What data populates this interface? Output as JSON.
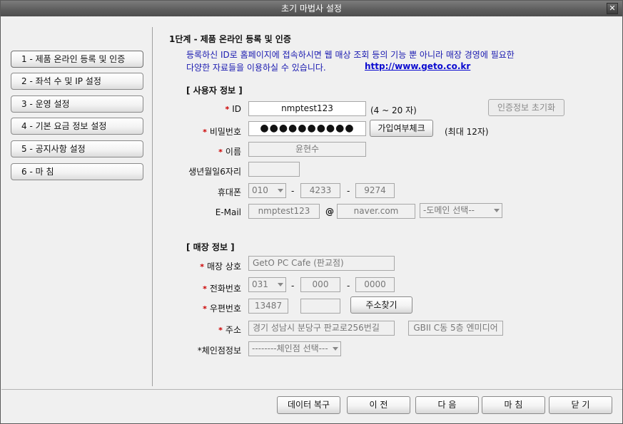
{
  "window": {
    "title": "초기 마법사 설정",
    "close_symbol": "✕"
  },
  "steps": [
    {
      "label": "1 - 제품 온라인 등록 및 인증"
    },
    {
      "label": "2 - 좌석 수 및 IP 설정"
    },
    {
      "label": "3 - 운영 설정"
    },
    {
      "label": "4 - 기본 요금 정보 설정"
    },
    {
      "label": "5 - 공지사항 설정"
    },
    {
      "label": "6 - 마 침"
    }
  ],
  "main": {
    "heading": "1단계 - 제품 온라인 등록 및 인증",
    "notice_line1": "등록하신 ID로 홈페이지에  접속하시면 웹 매상 조회 등의 기능 뿐 아니라 매장 경영에 필요한",
    "notice_line2": "다양한 자료들을 이용하실 수 있습니다.",
    "link": "http://www.geto.co.kr"
  },
  "user_section": {
    "title": "[ 사용자 정보 ]",
    "required_mark": "*",
    "id_label": "ID",
    "id_value": "nmptest123",
    "id_hint": "(4 ~ 20 자)",
    "reset_button": "인증정보 초기화",
    "password_label": "비밀번호",
    "password_value": "●●●●●●●●●●",
    "join_check_button": "가입여부체크",
    "password_hint": "(최대 12자)",
    "name_label": "이름",
    "name_value": "윤현수",
    "birth_label": "생년월일6자리",
    "birth_value": "",
    "phone_label": "휴대폰",
    "phone_prefix": "010",
    "phone_mid": "4233",
    "phone_last": "9274",
    "dash": "-",
    "email_label": "E-Mail",
    "email_id": "nmptest123",
    "email_at": "@",
    "email_domain": "naver.com",
    "email_domain_select": "-도메인 선택--"
  },
  "store_section": {
    "title": "[ 매장 정보 ]",
    "store_name_label": "매장 상호",
    "store_name_value": "GetO PC Cafe (판교점)",
    "tel_label": "전화번호",
    "tel_prefix": "031",
    "tel_mid": "000",
    "tel_last": "0000",
    "zip_label": "우편번호",
    "zip_value": "13487",
    "zip_value2": "",
    "address_search_button": "주소찾기",
    "address_label": "주소",
    "address_value": "경기 성남시 분당구 판교로256번길",
    "address_detail": "GBII C동 5층 엔미디어",
    "chain_label": "*체인점정보",
    "chain_select": "--------체인점 선택---"
  },
  "footer": {
    "restore_button": "데이터 복구",
    "prev_button": "이  전",
    "next_button": "다  음",
    "finish_button": "마  침",
    "close_button": "닫  기"
  }
}
